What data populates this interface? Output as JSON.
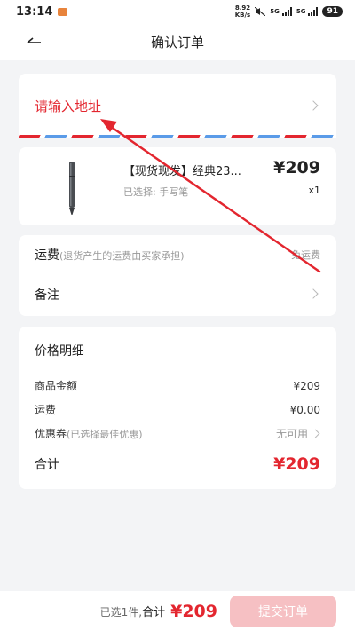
{
  "status_bar": {
    "time": "13:14",
    "net_speed": "8.92",
    "net_unit": "KB/s",
    "sig1": "5G",
    "sig2": "5G",
    "battery": "91"
  },
  "header": {
    "title": "确认订单"
  },
  "address": {
    "placeholder": "请输入地址"
  },
  "product": {
    "name": "【现货现发】经典23...",
    "price": "¥209",
    "variant": "已选择: 手写笔",
    "quantity": "x1"
  },
  "shipping": {
    "label": "运费",
    "hint": "(退货产生的运费由买家承担)",
    "value": "免运费",
    "note_label": "备注"
  },
  "price_detail": {
    "title": "价格明细",
    "goods_label": "商品金额",
    "goods_value": "¥209",
    "freight_label": "运费",
    "freight_value": "¥0.00",
    "coupon_label": "优惠券",
    "coupon_hint": "(已选择最佳优惠)",
    "coupon_value": "无可用",
    "total_label": "合计",
    "total_value": "¥209"
  },
  "bottom_bar": {
    "selected": "已选1件,",
    "total_label": "合计",
    "total_value": "¥209",
    "submit_label": "提交订单"
  },
  "colors": {
    "accent_red": "#e3262f",
    "submit_disabled": "#f6c0c3",
    "stripe_blue": "#5a9be8"
  }
}
